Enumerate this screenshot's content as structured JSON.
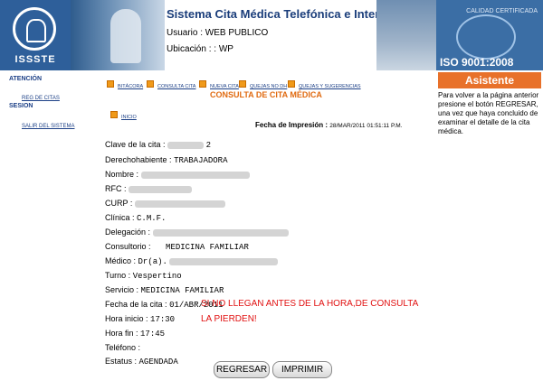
{
  "header": {
    "logo_text": "ISSSTE",
    "title": "Sistema Cita Médica Telefónica e Internet",
    "usuario_label": "Usuario :",
    "usuario_value": "WEB PUBLICO",
    "ubicacion_label": "Ubicación : :",
    "ubicacion_value": "WP",
    "cert_label": "CALIDAD CERTIFICADA",
    "cert_iso": "ISO 9001:2008",
    "assistant_label": "Asistente",
    "assistant_text": "Para volver a la página anterior presione el botón REGRESAR, una vez que haya concluido de examinar el detalle de la cita médica."
  },
  "sidebar": {
    "sections": [
      {
        "title": "ATENCIÓN",
        "items": [
          {
            "label": "REG DE CITAS"
          }
        ]
      },
      {
        "title": "SESION",
        "items": [
          {
            "label": "SALIR DEL SISTEMA"
          }
        ]
      }
    ]
  },
  "nav": {
    "items": [
      {
        "label": "BITÁCORA"
      },
      {
        "label": "CONSULTA CITA"
      },
      {
        "label": "NUEVA CITA"
      },
      {
        "label": "QUEJAS NO DH"
      },
      {
        "label": "QUEJAS Y SUGERENCIAS"
      },
      {
        "label": "INICIO"
      }
    ]
  },
  "page": {
    "title": "CONSULTA DE CITA MÉDICA",
    "print_label": "Fecha de Impresión :",
    "print_value": "28/MAR/2011 01:51:11 P.M."
  },
  "fields": [
    {
      "label": "Clave de la cita :",
      "value": "2"
    },
    {
      "label": "Derechohabiente :",
      "value": "TRABAJADORA"
    },
    {
      "label": "Nombre :",
      "value": ""
    },
    {
      "label": "RFC :",
      "value": ""
    },
    {
      "label": "CURP :",
      "value": ""
    },
    {
      "label": "Clínica :",
      "value": "C.M.F."
    },
    {
      "label": "Delegación :",
      "value": ""
    },
    {
      "label": "Consultorio :",
      "value": "MEDICINA FAMILIAR"
    },
    {
      "label": "Médico :",
      "value": "Dr(a)."
    },
    {
      "label": "Turno :",
      "value": "Vespertino"
    },
    {
      "label": "Servicio :",
      "value": "MEDICINA FAMILIAR"
    },
    {
      "label": "Fecha de la cita :",
      "value": "01/ABR/2011"
    },
    {
      "label": "Hora inicio :",
      "value": "17:30"
    },
    {
      "label": "Hora fin :",
      "value": "17:45"
    },
    {
      "label": "Teléfono :",
      "value": ""
    },
    {
      "label": "Estatus :",
      "value": "AGENDADA"
    }
  ],
  "notice": {
    "line1": "SI NO LLEGAN ANTES DE LA HORA,DE CONSULTA",
    "line2": "LA PIERDEN!"
  },
  "buttons": {
    "regresar": "REGRESAR",
    "imprimir": "IMPRIMIR"
  },
  "colors": {
    "accent_blue": "#1b3f86",
    "title_orange": "#e06a10",
    "notice_red": "#e11010",
    "assistant_orange": "#e8712a"
  }
}
